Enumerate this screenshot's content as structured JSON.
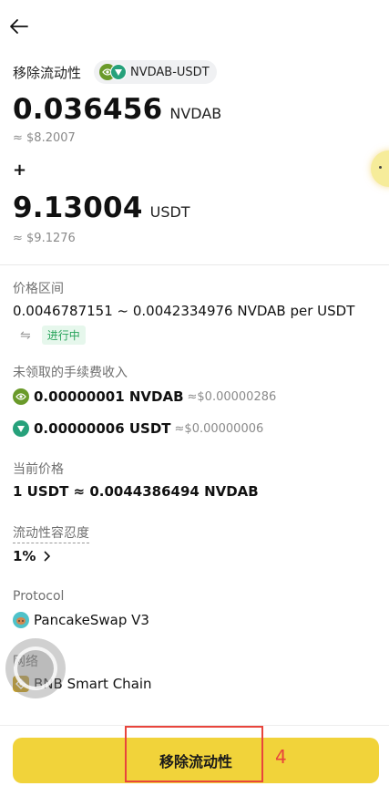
{
  "header": {
    "back_icon": "arrow-left-icon"
  },
  "title": "移除流动性",
  "pair": {
    "label": "NVDAB-USDT",
    "icons": [
      "nvdab-coin-icon",
      "usdt-coin-icon"
    ]
  },
  "token_a": {
    "amount": "0.036456",
    "unit": "NVDAB",
    "usd": "≈ $8.2007"
  },
  "plus": "+",
  "token_b": {
    "amount": "9.13004",
    "unit": "USDT",
    "usd": "≈ $9.1276"
  },
  "price_range": {
    "label": "价格区间",
    "value": "0.0046787151 ~ 0.0042334976 NVDAB per USDT",
    "swap_glyph": "⇋",
    "status": "进行中"
  },
  "fees": {
    "label": "未领取的手续费收入",
    "items": [
      {
        "amount": "0.00000001 NVDAB",
        "usd": "≈$0.00000286"
      },
      {
        "amount": "0.00000006 USDT",
        "usd": "≈$0.00000006"
      }
    ]
  },
  "current_price": {
    "label": "当前价格",
    "value": "1 USDT ≈ 0.0044386494 NVDAB"
  },
  "slippage": {
    "label": "流动性容忍度",
    "value": "1%"
  },
  "protocol": {
    "label": "Protocol",
    "value": "PancakeSwap V3"
  },
  "network": {
    "label": "网络",
    "value": "BNB Smart Chain"
  },
  "action": {
    "button_label": "移除流动性",
    "step_number": "4"
  },
  "colors": {
    "accent": "#f1d33a",
    "status_green": "#27a35a",
    "annotation_red": "#e8453c"
  }
}
